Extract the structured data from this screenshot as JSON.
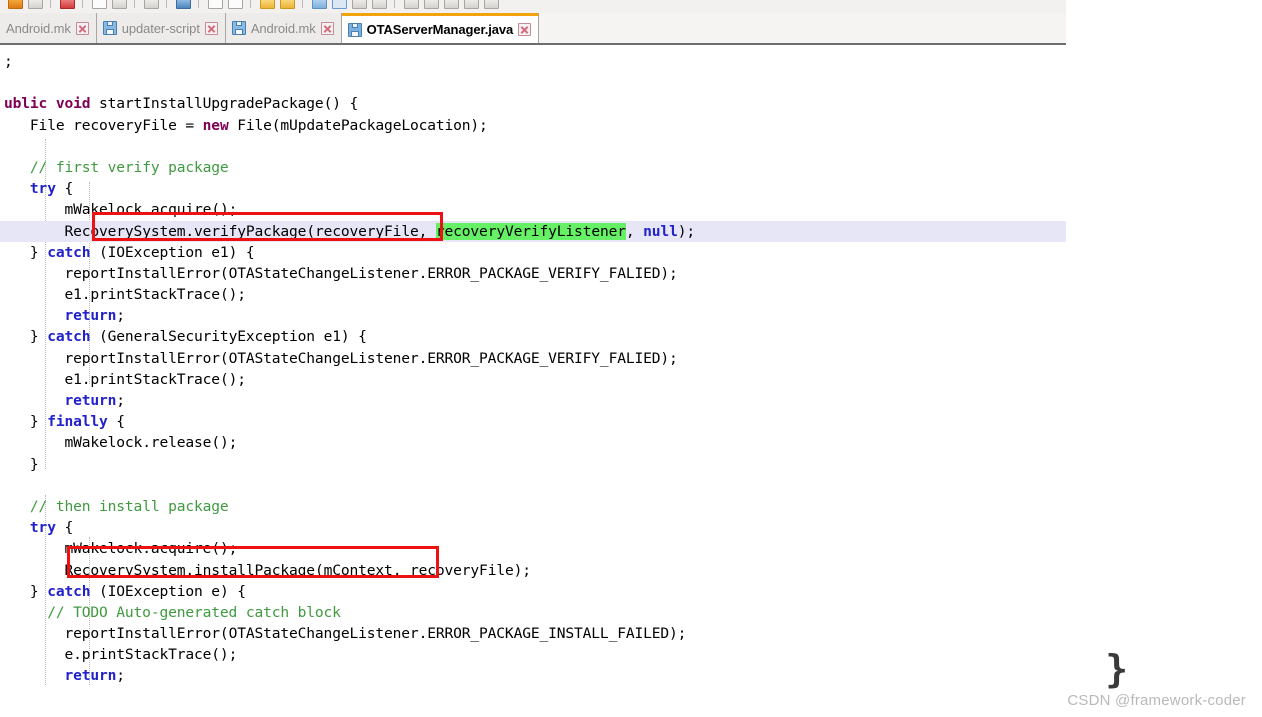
{
  "window": {
    "app": "Eclipse IDE",
    "active_file": "OTAServerManager.java"
  },
  "toolbar": {
    "items": [
      {
        "name": "save-icon",
        "style": "ico-orange"
      },
      {
        "name": "save-all-icon",
        "style": "ico-gray"
      },
      {
        "sep": true
      },
      {
        "name": "debug-icon",
        "style": "ico-red"
      },
      {
        "sep": true
      },
      {
        "name": "run-icon",
        "style": "ico-white"
      },
      {
        "name": "external-tools-icon",
        "style": "ico-gray"
      },
      {
        "sep": true
      },
      {
        "name": "new-icon",
        "style": "ico-gray"
      },
      {
        "sep": true
      },
      {
        "name": "search-icon",
        "style": "ico-dblue"
      },
      {
        "sep": true
      },
      {
        "name": "next-annotation-icon",
        "style": "ico-white"
      },
      {
        "name": "prev-annotation-icon",
        "style": "ico-white"
      },
      {
        "sep": true
      },
      {
        "name": "forward-icon",
        "style": "ico-yellow"
      },
      {
        "name": "back-icon",
        "style": "ico-yellow"
      },
      {
        "sep": true
      },
      {
        "name": "last-edit-icon",
        "style": "ico-blue"
      },
      {
        "name": "perspective-icon",
        "style": "ico-sel"
      },
      {
        "name": "open-perspective-icon",
        "style": "ico-gray"
      },
      {
        "name": "java-perspective-icon",
        "style": "ico-gray"
      },
      {
        "sep": true
      },
      {
        "name": "view-menu-icon",
        "style": "ico-gray"
      },
      {
        "name": "minimize-icon",
        "style": "ico-gray"
      },
      {
        "name": "maximize-icon",
        "style": "ico-gray"
      },
      {
        "name": "restore-icon",
        "style": "ico-gray"
      },
      {
        "name": "close-view-icon",
        "style": "ico-gray"
      }
    ]
  },
  "tabs": [
    {
      "label": "Android.mk",
      "active": false,
      "has_save_icon": false,
      "close_label": "close"
    },
    {
      "label": "updater-script",
      "active": false,
      "has_save_icon": true,
      "close_label": "close"
    },
    {
      "label": "Android.mk",
      "active": false,
      "has_save_icon": true,
      "close_label": "close"
    },
    {
      "label": "OTAServerManager.java",
      "active": true,
      "has_save_icon": true,
      "close_label": "close"
    }
  ],
  "code": {
    "language": "java",
    "lines": [
      ";",
      "",
      "ublic void startInstallUpgradePackage() {",
      "   File recoveryFile = new File(mUpdatePackageLocation);",
      "",
      "   // first verify package",
      "   try {",
      "       mWakelock.acquire();",
      "       RecoverySystem.verifyPackage(recoveryFile, recoveryVerifyListener, null);",
      "   } catch (IOException e1) {",
      "       reportInstallError(OTAStateChangeListener.ERROR_PACKAGE_VERIFY_FALIED);",
      "       e1.printStackTrace();",
      "       return;",
      "   } catch (GeneralSecurityException e1) {",
      "       reportInstallError(OTAStateChangeListener.ERROR_PACKAGE_VERIFY_FALIED);",
      "       e1.printStackTrace();",
      "       return;",
      "   } finally {",
      "       mWakelock.release();",
      "   }",
      "",
      "   // then install package",
      "   try {",
      "       mWakelock.acquire();",
      "       RecoverySystem.installPackage(mContext, recoveryFile);",
      "   } catch (IOException e) {",
      "     // TODO Auto-generated catch block",
      "       reportInstallError(OTAStateChangeListener.ERROR_PACKAGE_INSTALL_FAILED);",
      "       e.printStackTrace();",
      "       return;"
    ],
    "current_line_index": 8,
    "search_highlight_text": "recoveryVerifyListener",
    "annotations": [
      {
        "name": "verify-package-callout",
        "text": "RecoverySystem.verifyPackage",
        "color": "#ee1111"
      },
      {
        "name": "install-package-callout",
        "text": "RecoverySystem.installPackage",
        "color": "#ee1111"
      }
    ],
    "colors": {
      "keyword": "#7f0055",
      "control_keyword": "#2222cc",
      "comment": "#3f9a3f",
      "plain": "#000000",
      "current_line_bg": "#e6e6f7",
      "search_highlight_bg": "#66f066",
      "callout_border": "#ee1111",
      "tab_active_accent": "#f0a30a"
    }
  },
  "watermark": {
    "brace": "}",
    "text": "CSDN @framework-coder"
  }
}
